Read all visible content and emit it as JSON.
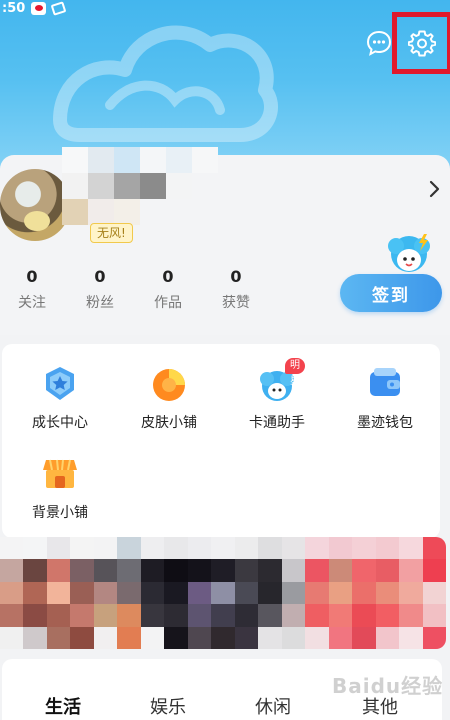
{
  "status_bar": {
    "time": ":50"
  },
  "profile": {
    "badge": "无风!",
    "stats": [
      {
        "value": "0",
        "label": "关注"
      },
      {
        "value": "0",
        "label": "粉丝"
      },
      {
        "value": "0",
        "label": "作品"
      },
      {
        "value": "0",
        "label": "获赞"
      }
    ],
    "checkin_label": "签到"
  },
  "services": [
    {
      "label": "成长中心",
      "icon": "medal-icon"
    },
    {
      "label": "皮肤小铺",
      "icon": "skin-shop-icon"
    },
    {
      "label": "卡通助手",
      "icon": "cartoon-assistant-icon",
      "badge": "明星"
    },
    {
      "label": "墨迹钱包",
      "icon": "wallet-icon"
    },
    {
      "label": "背景小铺",
      "icon": "background-shop-icon"
    }
  ],
  "tabs": [
    {
      "label": "生活",
      "active": true
    },
    {
      "label": "娱乐",
      "active": false
    },
    {
      "label": "休闲",
      "active": false
    },
    {
      "label": "其他",
      "active": false
    }
  ],
  "watermark": "Baidu经验",
  "colors": {
    "header_blue": "#43b6ee",
    "checkin_blue": "#3d97ea",
    "highlight_red": "#e0192c",
    "badge_red": "#f3434d"
  }
}
